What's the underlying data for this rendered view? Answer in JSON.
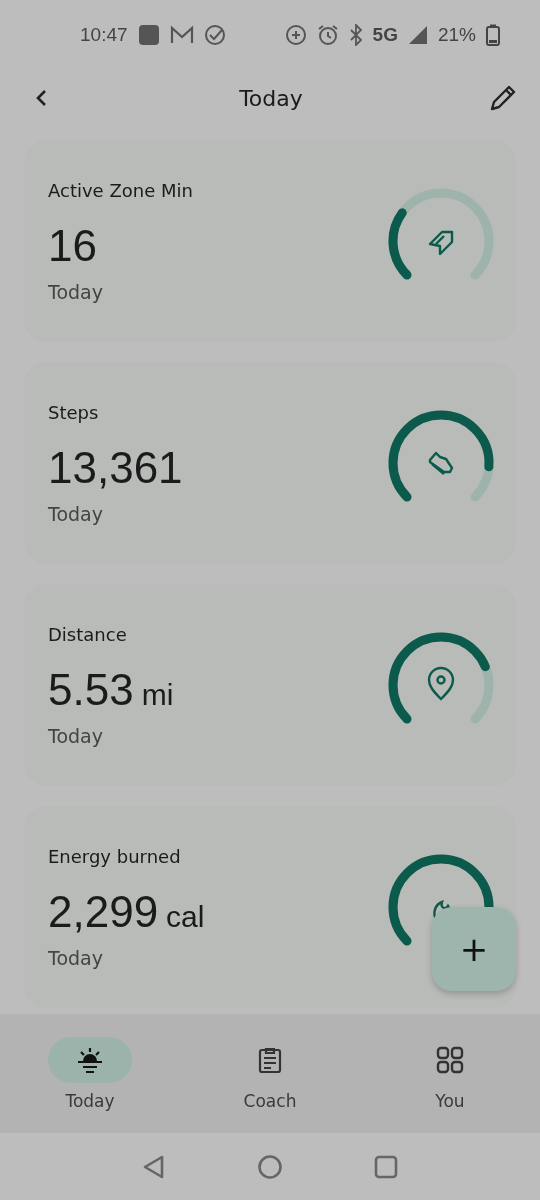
{
  "status_bar": {
    "time": "10:47",
    "network": "5G",
    "battery": "21%"
  },
  "header": {
    "title": "Today"
  },
  "cards": [
    {
      "kind": "zone",
      "label": "Active Zone Min",
      "value": "16",
      "period": "Today"
    },
    {
      "kind": "steps",
      "label": "Steps",
      "value": "13,361",
      "period": "Today"
    },
    {
      "kind": "distance",
      "label": "Distance",
      "value": "5.53",
      "unit": "mi",
      "period": "Today"
    },
    {
      "kind": "energy",
      "label": "Energy burned",
      "value": "2,299",
      "unit": "cal",
      "period": "Today"
    }
  ],
  "fab": {
    "label": "+"
  },
  "nav": [
    {
      "kind": "today",
      "label": "Today",
      "selected": true
    },
    {
      "kind": "coach",
      "label": "Coach",
      "selected": false
    },
    {
      "kind": "you",
      "label": "You",
      "selected": false
    }
  ]
}
